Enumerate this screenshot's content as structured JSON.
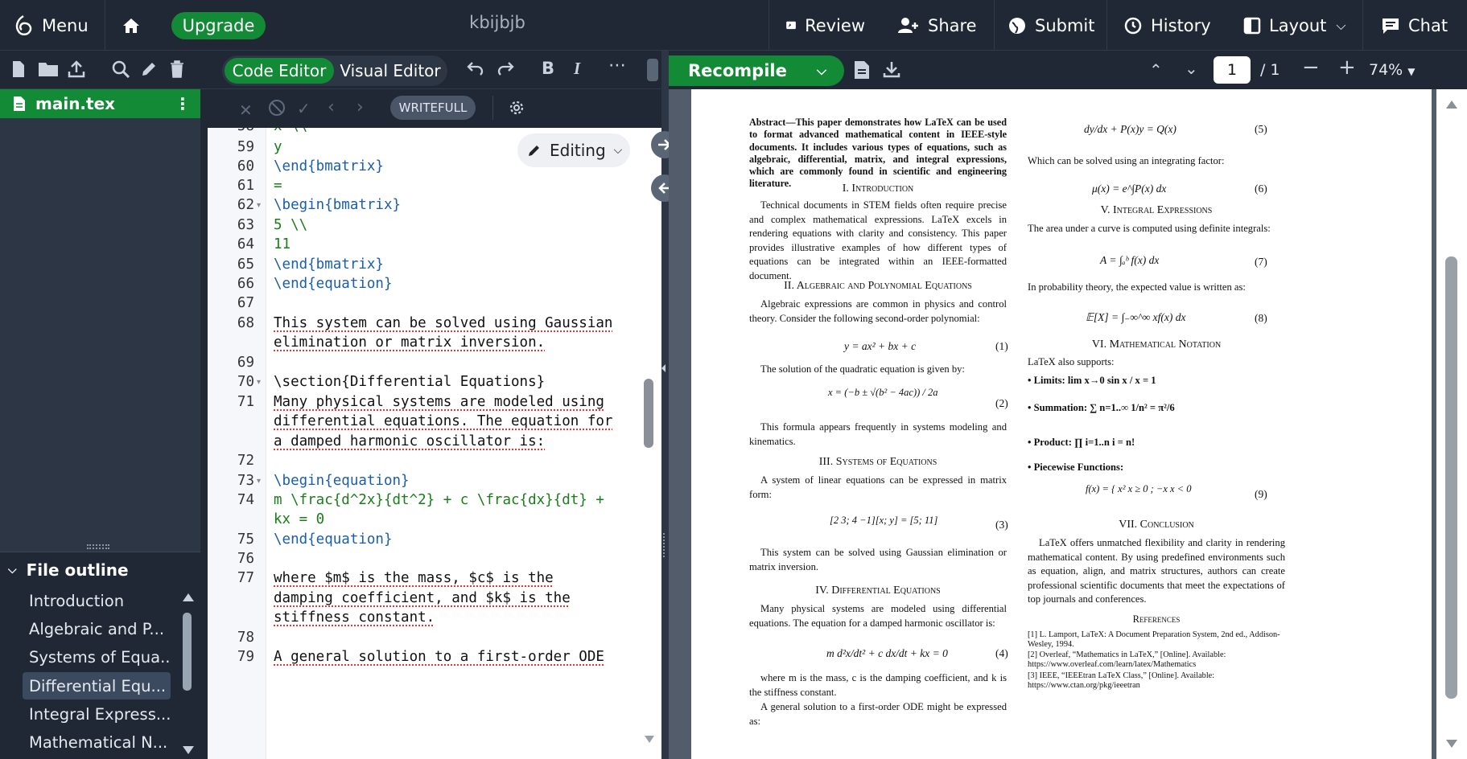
{
  "topbar": {
    "menu": "Menu",
    "upgrade": "Upgrade",
    "project_title": "kbijbjb",
    "review": "Review",
    "share": "Share",
    "submit": "Submit",
    "history": "History",
    "layout": "Layout",
    "chat": "Chat"
  },
  "sidebar": {
    "file_name": "main.tex",
    "outline_title": "File outline",
    "outline_items": [
      "Introduction",
      "Algebraic and P...",
      "Systems of Equa...",
      "Differential Equ...",
      "Integral Express...",
      "Mathematical N..."
    ]
  },
  "editor": {
    "code_editor": "Code Editor",
    "visual_editor": "Visual Editor",
    "writefull": "WRITEFULL",
    "editing": "Editing",
    "lines": [
      {
        "n": "59",
        "text": "y"
      },
      {
        "n": "60",
        "text": "\\end{bmatrix}"
      },
      {
        "n": "61",
        "text": "="
      },
      {
        "n": "62",
        "text": "\\begin{bmatrix}"
      },
      {
        "n": "63",
        "text": "5 \\\\"
      },
      {
        "n": "64",
        "text": "11"
      },
      {
        "n": "65",
        "text": "\\end{bmatrix}"
      },
      {
        "n": "66",
        "text": "\\end{equation}"
      },
      {
        "n": "67",
        "text": ""
      },
      {
        "n": "68",
        "text": "This system can be solved using Gaussian"
      },
      {
        "n": "68b",
        "text": "elimination or matrix inversion."
      },
      {
        "n": "69",
        "text": ""
      },
      {
        "n": "70",
        "text": "\\section{Differential Equations}"
      },
      {
        "n": "71",
        "text": "Many physical systems are modeled using"
      },
      {
        "n": "71b",
        "text": "differential equations. The equation for"
      },
      {
        "n": "71c",
        "text": "a damped harmonic oscillator is:"
      },
      {
        "n": "72",
        "text": ""
      },
      {
        "n": "73",
        "text": "\\begin{equation}"
      },
      {
        "n": "74",
        "text": "m \\frac{d^2x}{dt^2} + c \\frac{dx}{dt} +"
      },
      {
        "n": "74b",
        "text": "kx = 0"
      },
      {
        "n": "75",
        "text": "\\end{equation}"
      },
      {
        "n": "76",
        "text": ""
      },
      {
        "n": "77",
        "text": "where $m$ is the mass, $c$ is the"
      },
      {
        "n": "77b",
        "text": "damping coefficient, and $k$ is the"
      },
      {
        "n": "77c",
        "text": "stiffness constant."
      },
      {
        "n": "78",
        "text": ""
      },
      {
        "n": "79",
        "text": "A general solution to a first-order ODE"
      }
    ]
  },
  "pdf": {
    "recompile": "Recompile",
    "page_current": "1",
    "page_total": "/ 1",
    "zoom": "74%",
    "abstract": "Abstract—This paper demonstrates how LaTeX can be used to format advanced mathematical content in IEEE-style documents. It includes various types of equations, such as algebraic, differential, matrix, and integral expressions, which are commonly found in scientific and engineering literature.",
    "s1": "I. Introduction",
    "p1": "Technical documents in STEM fields often require precise and complex mathematical expressions. LaTeX excels in rendering equations with clarity and consistency. This paper provides illustrative examples of how different types of equations can be integrated within an IEEE-formatted document.",
    "s2": "II. Algebraic and Polynomial Equations",
    "p2": "Algebraic expressions are common in physics and control theory. Consider the following second-order polynomial:",
    "eq1": "y = ax² + bx + c",
    "p2b": "The solution of the quadratic equation is given by:",
    "eq2": "x = (−b ± √(b² − 4ac)) / 2a",
    "p2c": "This formula appears frequently in systems modeling and kinematics.",
    "s3": "III. Systems of Equations",
    "p3": "A system of linear equations can be expressed in matrix form:",
    "eq3": "[2 3; 4 −1][x; y] = [5; 11]",
    "p3b": "This system can be solved using Gaussian elimination or matrix inversion.",
    "s4": "IV. Differential Equations",
    "p4": "Many physical systems are modeled using differential equations. The equation for a damped harmonic oscillator is:",
    "eq4": "m d²x/dt² + c dx/dt + kx = 0",
    "p4b": "where m is the mass, c is the damping coefficient, and k is the stiffness constant.",
    "p4c": "A general solution to a first-order ODE might be expressed as:",
    "eq5": "dy/dx + P(x)y = Q(x)",
    "p5": "Which can be solved using an integrating factor:",
    "eq6": "μ(x) = e^∫P(x) dx",
    "s5": "V. Integral Expressions",
    "p6": "The area under a curve is computed using definite integrals:",
    "eq7": "A = ∫ₐᵇ f(x) dx",
    "p6b": "In probability theory, the expected value is written as:",
    "eq8": "𝔼[X] = ∫₋∞^∞ xf(x) dx",
    "s6": "VI. Mathematical Notation",
    "p7": "LaTeX also supports:",
    "b1": "Limits: lim x→0 sin x / x = 1",
    "b2": "Summation: ∑ n=1..∞ 1/n² = π²/6",
    "b3": "Product: ∏ i=1..n i = n!",
    "b4": "Piecewise Functions:",
    "eq9": "f(x) = { x²  x ≥ 0 ;  −x  x < 0",
    "s7": "VII. Conclusion",
    "p8": "LaTeX offers unmatched flexibility and clarity in rendering mathematical content. By using predefined environments such as equation, align, and matrix structures, authors can create professional scientific documents that meet the expectations of top journals and conferences.",
    "refs_title": "References",
    "r1": "[1] L. Lamport, LaTeX: A Document Preparation System, 2nd ed., Addison-Wesley, 1994.",
    "r2": "[2] Overleaf, “Mathematics in LaTeX,” [Online]. Available: https://www.overleaf.com/learn/latex/Mathematics",
    "r3": "[3] IEEE, “IEEEtran LaTeX Class,” [Online]. Available: https://www.ctan.org/pkg/ieeetran"
  }
}
